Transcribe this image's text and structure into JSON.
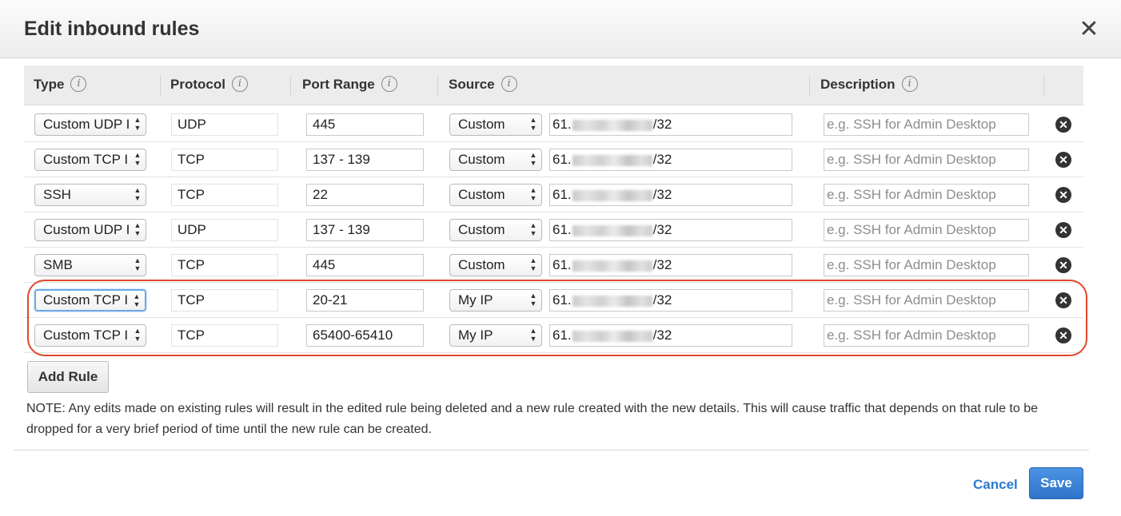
{
  "dialog": {
    "title": "Edit inbound rules",
    "close_label": "✕"
  },
  "columns": {
    "type": "Type",
    "protocol": "Protocol",
    "port_range": "Port Range",
    "source": "Source",
    "description": "Description",
    "info_glyph": "i"
  },
  "rows": [
    {
      "type": "Custom UDP I",
      "protocol": "UDP",
      "port_range": "445",
      "source": "Custom",
      "ip_prefix": "61.",
      "ip_suffix": "/32",
      "description_placeholder": "e.g. SSH for Admin Desktop"
    },
    {
      "type": "Custom TCP I",
      "protocol": "TCP",
      "port_range": "137 - 139",
      "source": "Custom",
      "ip_prefix": "61.",
      "ip_suffix": "/32",
      "description_placeholder": "e.g. SSH for Admin Desktop"
    },
    {
      "type": "SSH",
      "protocol": "TCP",
      "port_range": "22",
      "source": "Custom",
      "ip_prefix": "61.",
      "ip_suffix": "/32",
      "description_placeholder": "e.g. SSH for Admin Desktop"
    },
    {
      "type": "Custom UDP I",
      "protocol": "UDP",
      "port_range": "137 - 139",
      "source": "Custom",
      "ip_prefix": "61.",
      "ip_suffix": "/32",
      "description_placeholder": "e.g. SSH for Admin Desktop"
    },
    {
      "type": "SMB",
      "protocol": "TCP",
      "port_range": "445",
      "source": "Custom",
      "ip_prefix": "61.",
      "ip_suffix": "/32",
      "description_placeholder": "e.g. SSH for Admin Desktop"
    },
    {
      "type": "Custom TCP I",
      "protocol": "TCP",
      "port_range": "20-21",
      "source": "My IP",
      "ip_prefix": "61.",
      "ip_suffix": "/32",
      "description_placeholder": "e.g. SSH for Admin Desktop"
    },
    {
      "type": "Custom TCP I",
      "protocol": "TCP",
      "port_range": "65400-65410",
      "source": "My IP",
      "ip_prefix": "61.",
      "ip_suffix": "/32",
      "description_placeholder": "e.g. SSH for Admin Desktop"
    }
  ],
  "focused_row": 5,
  "select_arrows": "▲▼",
  "delete_glyph": "✕",
  "actions": {
    "add_rule": "Add Rule",
    "cancel": "Cancel",
    "save": "Save"
  },
  "note": "NOTE: Any edits made on existing rules will result in the edited rule being deleted and a new rule created with the new details. This will cause traffic that depends on that rule to be dropped for a very brief period of time until the new rule can be created.",
  "colors": {
    "accent": "#2a7ad1",
    "save_button": "#3a80d6",
    "highlight_outline": "#e2462a",
    "focus_ring": "#6aa8e8"
  }
}
